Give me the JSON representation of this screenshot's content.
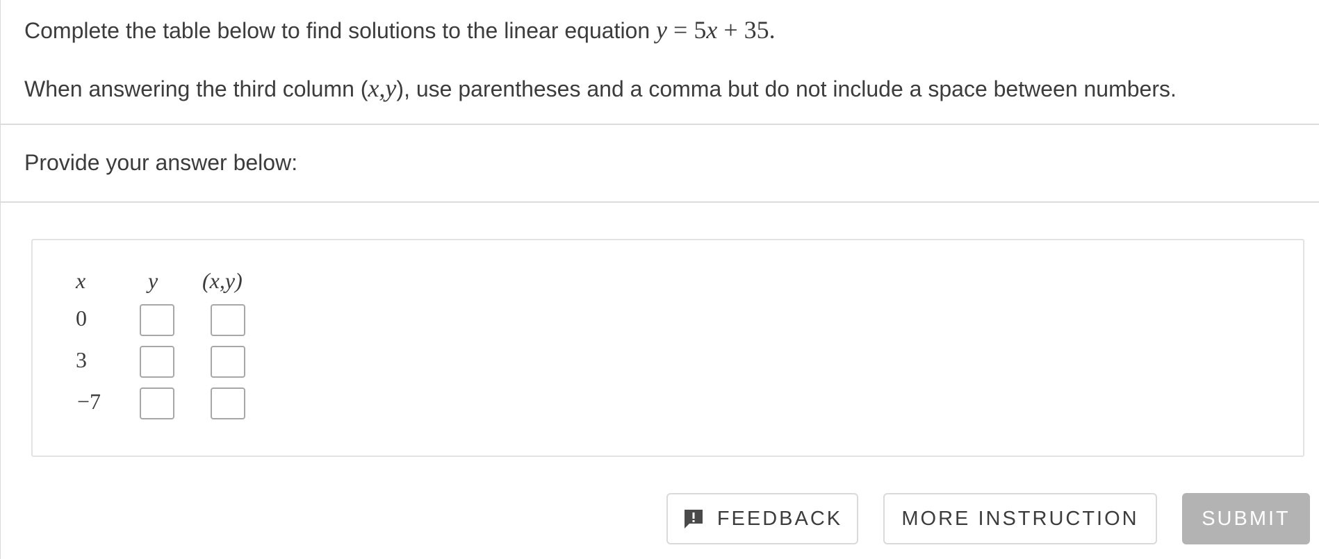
{
  "question": {
    "line1_text": "Complete the table below to find solutions to the linear equation ",
    "equation": {
      "lhs": "y",
      "eq": " = ",
      "coef": "5",
      "var": "x",
      "rest": " + 35",
      "period": "."
    },
    "line2_before": "When answering the third column (",
    "line2_math": "x,y",
    "line2_after": "), use parentheses and a comma but do not include a space between numbers."
  },
  "prompt": {
    "label": "Provide your answer below:"
  },
  "table": {
    "headers": {
      "x": "x",
      "y": "y",
      "xy": "(x,y)"
    },
    "rows": [
      {
        "x": "0",
        "y_value": "",
        "xy_value": ""
      },
      {
        "x": "3",
        "y_value": "",
        "xy_value": ""
      },
      {
        "x": "−7",
        "y_value": "",
        "xy_value": ""
      }
    ]
  },
  "buttons": {
    "feedback": "FEEDBACK",
    "more_instruction": "MORE INSTRUCTION",
    "submit": "SUBMIT"
  },
  "icons": {
    "feedback": "feedback-alert-icon"
  },
  "colors": {
    "submit_bg": "#b3b3b3",
    "text": "#3c3c3c",
    "border": "#dcdcdc"
  }
}
